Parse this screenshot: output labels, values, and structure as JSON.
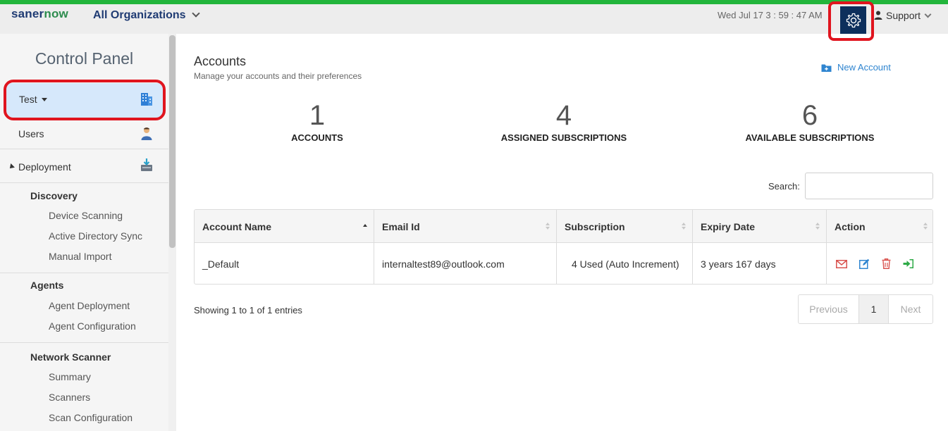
{
  "topbar": {
    "logo_part1": "saner",
    "logo_part2": "now",
    "org_selector": "All Organizations",
    "datetime": "Wed Jul 17  3 : 59 : 47 AM",
    "support_label": "Support"
  },
  "sidebar": {
    "title": "Control Panel",
    "account_selector": "Test",
    "users_label": "Users",
    "deployment_label": "Deployment",
    "discovery": {
      "heading": "Discovery",
      "items": [
        "Device Scanning",
        "Active Directory Sync",
        "Manual Import"
      ]
    },
    "agents": {
      "heading": "Agents",
      "items": [
        "Agent Deployment",
        "Agent Configuration"
      ]
    },
    "network_scanner": {
      "heading": "Network Scanner",
      "items": [
        "Summary",
        "Scanners",
        "Scan Configuration"
      ]
    }
  },
  "main": {
    "title": "Accounts",
    "subtitle": "Manage your accounts and their preferences",
    "new_account_label": "New Account",
    "stats": [
      {
        "value": "1",
        "label": "ACCOUNTS"
      },
      {
        "value": "4",
        "label": "ASSIGNED SUBSCRIPTIONS"
      },
      {
        "value": "6",
        "label": "AVAILABLE SUBSCRIPTIONS"
      }
    ],
    "search_label": "Search:",
    "search_value": "",
    "table": {
      "columns": [
        "Account Name",
        "Email Id",
        "Subscription",
        "Expiry Date",
        "Action"
      ],
      "rows": [
        {
          "account_name": "_Default",
          "email": "internaltest89@outlook.com",
          "subscription": "4 Used (Auto Increment)",
          "expiry": "3 years 167 days"
        }
      ]
    },
    "showing": "Showing 1 to 1 of 1 entries",
    "pager": {
      "previous": "Previous",
      "current": "1",
      "next": "Next"
    }
  },
  "colors": {
    "accent_green": "#22b53b",
    "brand_navy": "#1f3b73",
    "gear_button": "#0d2f5c",
    "highlight_red": "#e0141e",
    "link_blue": "#2f85d0",
    "selected_bg": "#d6e8fb"
  },
  "icons": [
    "gear-icon",
    "user-icon",
    "building-icon",
    "users-icon",
    "deployment-icon",
    "folder-plus-icon",
    "mail-icon",
    "edit-icon",
    "delete-icon",
    "login-icon",
    "sort-icon"
  ]
}
